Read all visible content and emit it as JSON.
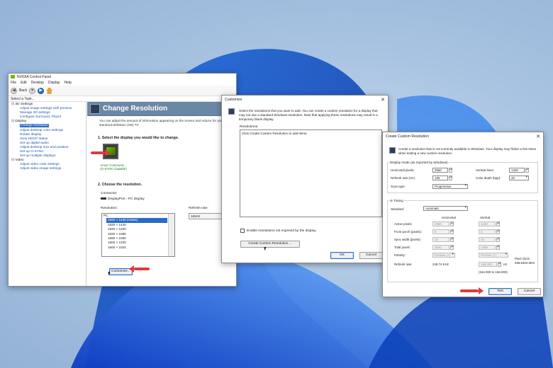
{
  "nvidia": {
    "title": "NVIDIA Control Panel",
    "menu": [
      "File",
      "Edit",
      "Desktop",
      "Display",
      "Help"
    ],
    "back_label": "Back",
    "task_label": "Select a Task...",
    "tree": {
      "cat_3d": "3D Settings",
      "items_3d": [
        "Adjust image settings with preview",
        "Manage 3D settings",
        "Configure Surround, PhysX"
      ],
      "cat_display": "Display",
      "items_display": [
        "Change resolution",
        "Adjust desktop color settings",
        "Rotate display",
        "View HDCP status",
        "Set up digital audio",
        "Adjust desktop size and position",
        "Set up G-SYNC",
        "Set up multiple displays"
      ],
      "cat_video": "Video",
      "items_video": [
        "Adjust video color settings",
        "Adjust video image settings"
      ]
    },
    "heading": "Change Resolution",
    "description": "You can adjust the amount of information appearing on the screen and reduce for your standard-definition (SD) TV.",
    "step1": "1. Select the display you would like to change.",
    "monitor_name": "Anvor Communic...",
    "monitor_sub": "(G-SYNC Capable)",
    "step2": "2. Choose the resolution.",
    "connector_label": "Connector:",
    "connector_value": "DisplayPort - PC display",
    "resolution_label": "Resolution:",
    "refresh_label": "Refresh rate:",
    "refresh_value": "165Hz",
    "res_group": "PC",
    "resolutions": [
      "2560 × 1440 (native)",
      "1920 × 1440",
      "1920 × 1200",
      "1920 × 1080",
      "1680 × 1050",
      "1600 × 1200",
      "1600 × 1024"
    ],
    "customize_button": "Customize..."
  },
  "customize": {
    "title": "Customize",
    "text": "Select the resolutions that you want to add. You can create a custom resolution for a display that may not use a standard Windows resolution. Note that applying these resolutions may result in a temporary blank display.",
    "resolutions_label": "Resolutions:",
    "empty_hint": "Click Create Custom Resolution to add items.",
    "checkbox_label": "Enable resolutions not exposed by the display",
    "create_button": "Create Custom Resolution ...",
    "ok": "OK",
    "cancel": "Cancel"
  },
  "ccr": {
    "title": "Create Custom Resolution",
    "text": "Create a resolution that is not currently available in Windows. Your display may flicker a few times when testing a new custom resolution.",
    "mode_group": "Display mode (as reported by Windows)",
    "h_pixels_label": "Horizontal pixels:",
    "h_pixels": "2560",
    "v_lines_label": "Vertical lines:",
    "v_lines": "1440",
    "refresh_label": "Refresh rate (Hz):",
    "refresh": "165",
    "depth_label": "Color depth (bpp):",
    "depth": "32",
    "scan_label": "Scan type:",
    "scan": "Progressive",
    "timing_group": "Timing",
    "standard_label": "Standard:",
    "standard": "Automatic",
    "col_h": "Horizontal",
    "col_v": "Vertical",
    "active_label": "Active pixels:",
    "active_h": "2560",
    "active_v": "1440",
    "porch_label": "Front porch (pixels):",
    "porch_h": "8",
    "porch_v": "3",
    "sync_label": "Sync width (pixels):",
    "sync_h": "32",
    "sync_v": "10",
    "total_label": "Total pixels:",
    "total_h": "2640",
    "total_v": "1469",
    "polarity_label": "Polarity:",
    "polarity_h": "Positive (+)",
    "polarity_v": "Positive (+)",
    "pixel_clock_label": "Pixel clock:",
    "pixel_clock": "639.5404 MHz",
    "refresh_rate_label": "Refresh rate:",
    "refresh_rate_h": "240.74 KHz",
    "refresh_rate_v": "165.000",
    "hz_unit": "Hz",
    "range": "(164.000 to 166.000)",
    "test_button": "Test",
    "cancel_button": "Cancel"
  },
  "colors": {
    "arrow": "#e03a3a",
    "nvidia_green": "#76b900",
    "header": "#6b87a6"
  }
}
